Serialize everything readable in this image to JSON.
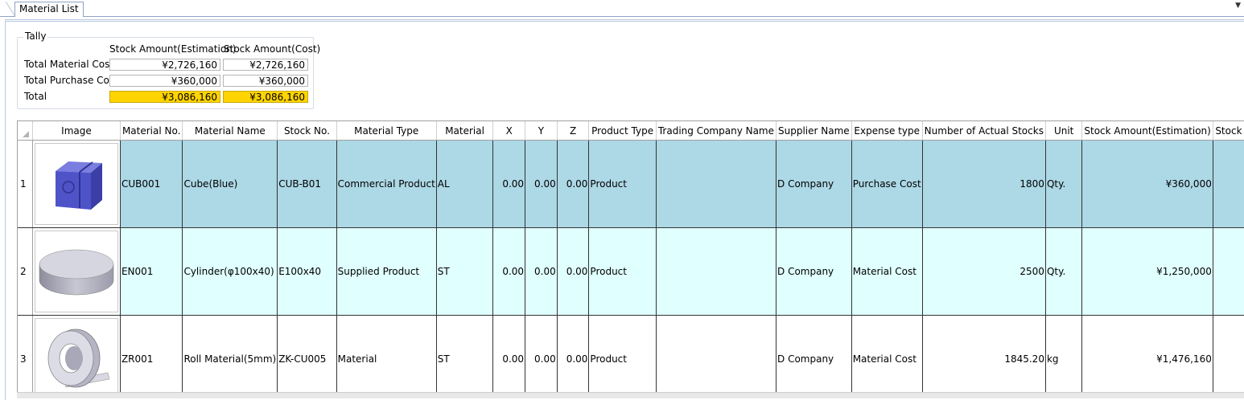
{
  "tab": {
    "label": "Material List"
  },
  "tally": {
    "legend": "Tally",
    "col_estimation": "Stock Amount(Estimation)",
    "col_cost": "Stock Amount(Cost)",
    "rows": [
      {
        "label": "Total Material Cost",
        "estimation": "¥2,726,160",
        "cost": "¥2,726,160"
      },
      {
        "label": "Total Purchase Cost",
        "estimation": "¥360,000",
        "cost": "¥360,000"
      },
      {
        "label": "Total",
        "estimation": "¥3,086,160",
        "cost": "¥3,086,160"
      }
    ],
    "highlight_color": "#ffd400"
  },
  "grid": {
    "columns": [
      "Image",
      "Material No.",
      "Material Name",
      "Stock No.",
      "Material Type",
      "Material",
      "X",
      "Y",
      "Z",
      "Product Type",
      "Trading Company Name",
      "Supplier Name",
      "Expense type",
      "Number of Actual Stocks",
      "Unit",
      "Stock Amount(Estimation)",
      "Stock"
    ],
    "rows": [
      {
        "index": "1",
        "image_icon": "blue-cube-icon",
        "material_no": "CUB001",
        "material_name": "Cube(Blue)",
        "stock_no": "CUB-B01",
        "material_type": "Commercial Product",
        "material": "AL",
        "x": "0.00",
        "y": "0.00",
        "z": "0.00",
        "product_type": "Product",
        "trading_company": "",
        "supplier": "D Company",
        "expense_type": "Purchase Cost",
        "actual_stocks": "1800",
        "unit": "Qty.",
        "stock_amount_est": "¥360,000"
      },
      {
        "index": "2",
        "image_icon": "cylinder-icon",
        "material_no": "EN001",
        "material_name": "Cylinder(φ100x40)",
        "stock_no": "E100x40",
        "material_type": "Supplied Product",
        "material": "ST",
        "x": "0.00",
        "y": "0.00",
        "z": "0.00",
        "product_type": "Product",
        "trading_company": "",
        "supplier": "D Company",
        "expense_type": "Material Cost",
        "actual_stocks": "2500",
        "unit": "Qty.",
        "stock_amount_est": "¥1,250,000"
      },
      {
        "index": "3",
        "image_icon": "roll-material-icon",
        "material_no": "ZR001",
        "material_name": "Roll Material(5mm)",
        "stock_no": "ZK-CU005",
        "material_type": "Material",
        "material": "ST",
        "x": "0.00",
        "y": "0.00",
        "z": "0.00",
        "product_type": "Product",
        "trading_company": "",
        "supplier": "D Company",
        "expense_type": "Material Cost",
        "actual_stocks": "1845.20",
        "unit": "kg",
        "stock_amount_est": "¥1,476,160"
      }
    ],
    "row_colors": [
      "#add8e6",
      "#e0ffff",
      "#ffffff"
    ]
  }
}
